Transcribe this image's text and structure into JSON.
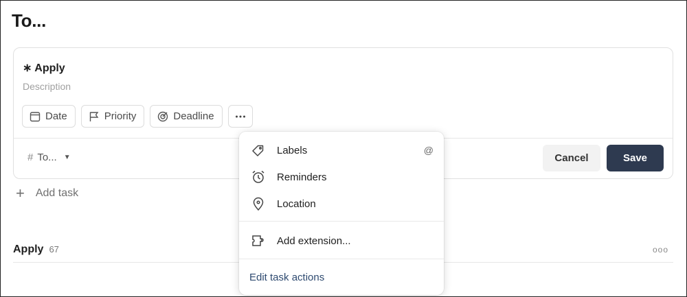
{
  "page": {
    "title": "To..."
  },
  "editor": {
    "task_name": "∗ Apply",
    "description_placeholder": "Description",
    "chips": [
      {
        "label": "Date",
        "icon": "calendar-icon"
      },
      {
        "label": "Priority",
        "icon": "flag-icon"
      },
      {
        "label": "Deadline",
        "icon": "target-icon"
      },
      {
        "label": "",
        "icon": "more-horizontal-icon"
      }
    ],
    "project": {
      "hash": "#",
      "label": "To...",
      "caret": "▼"
    },
    "cancel_label": "Cancel",
    "save_label": "Save"
  },
  "add_task": {
    "plus": "+",
    "label": "Add task"
  },
  "section": {
    "title": "Apply",
    "count": "67",
    "more": "ooo"
  },
  "menu": {
    "items": [
      {
        "label": "Labels",
        "icon": "tag-icon",
        "shortcut": "@"
      },
      {
        "label": "Reminders",
        "icon": "alarm-clock-icon",
        "shortcut": ""
      },
      {
        "label": "Location",
        "icon": "location-pin-icon",
        "shortcut": ""
      },
      {
        "label": "Add extension...",
        "icon": "puzzle-icon",
        "shortcut": ""
      }
    ],
    "edit_actions_label": "Edit task actions"
  },
  "colors": {
    "accent": "#2e3a50",
    "link": "#2e4a70",
    "border": "#e0e0e0"
  }
}
